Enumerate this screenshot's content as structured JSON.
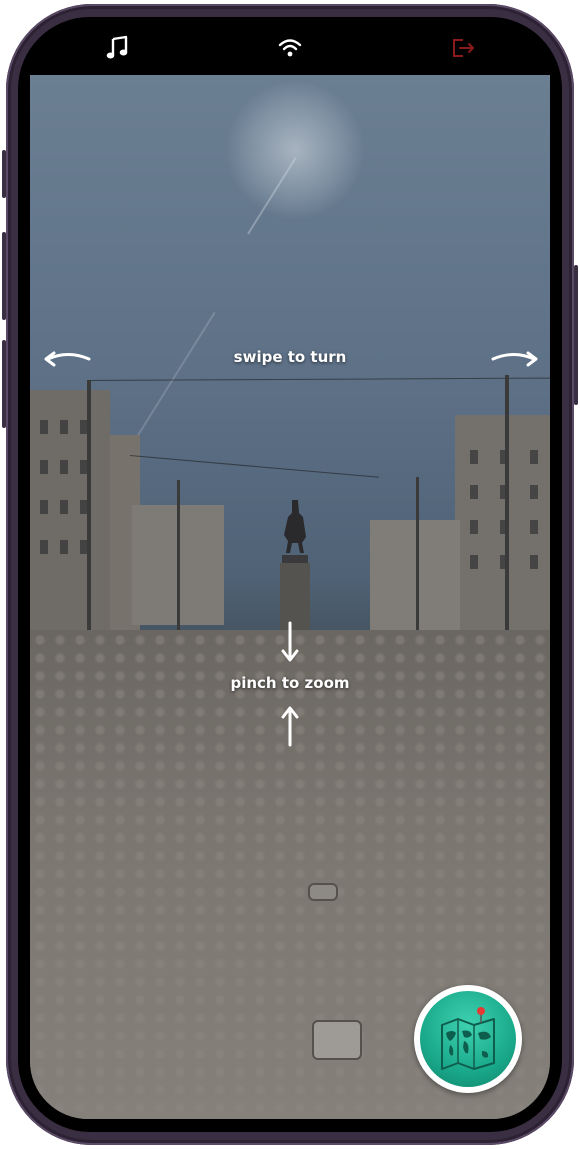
{
  "status_bar": {
    "music_icon": "music-note-icon",
    "wifi_icon": "wifi-icon",
    "exit_icon": "exit-icon",
    "exit_color": "#8b1a1a"
  },
  "hints": {
    "swipe_label": "swipe to turn",
    "pinch_label": "pinch to zoom"
  },
  "map_button": {
    "icon": "world-map-icon",
    "bg_color": "#19a98a",
    "pin_color": "#e53935"
  }
}
